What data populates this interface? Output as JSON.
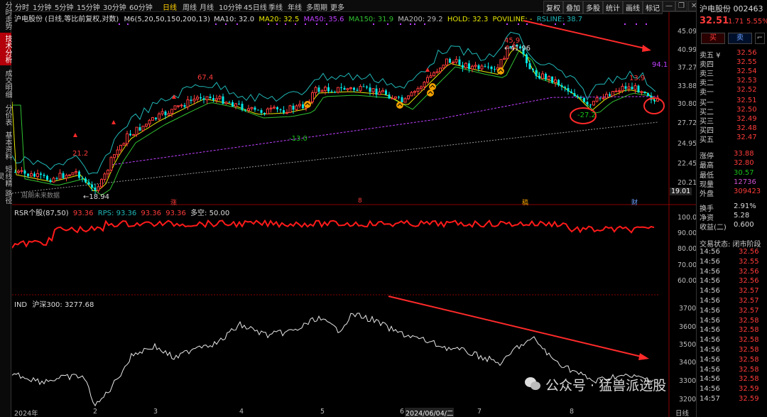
{
  "left_nav": [
    "分时走势",
    "技术分析",
    "成交明细",
    "分价表",
    "基本资料",
    "短线精灵",
    "路径"
  ],
  "toolbar": {
    "periods": [
      "分时",
      "1分钟",
      "5分钟",
      "15分钟",
      "30分钟",
      "60分钟",
      "日线",
      "周线",
      "月线",
      "10分钟",
      "45日线",
      "季线",
      "年线",
      "多周期",
      "更多"
    ],
    "active_period": "日线",
    "right_buttons": [
      "复权",
      "叠加",
      "多股",
      "统计",
      "画线",
      "标记"
    ]
  },
  "main_legend": {
    "stock": "沪电股份 (日线,等比前复权,对数)",
    "m6": "M6(5,20,50,150,200,13)",
    "ma10": "MA10: 32.0",
    "ma20": "MA20: 32.5",
    "ma50": "MA50: 35.6",
    "ma150": "MA150: 31.9",
    "ma200": "MA200: 29.2",
    "hold": "HOLD: 32.3",
    "poviline": "POVILINE: -",
    "rsline": "RSLINE: 38.7"
  },
  "price_axis": [
    "45.09",
    "40.99",
    "37.27",
    "33.88",
    "30.80",
    "27.72",
    "24.95",
    "22.45",
    "20.21",
    "19.01"
  ],
  "annotations": {
    "high1": "21.2",
    "low1": "18.94",
    "high2": "67.4",
    "low2": "-13.0",
    "high3": "45.9",
    "high3b": "41.96",
    "mid": "-27.2",
    "right1": "94.1",
    "right2": "13.9",
    "nodata": "周期未来数据"
  },
  "event_markers": [
    "涨",
    "8",
    "稿",
    "财"
  ],
  "rsr_legend": {
    "title": "RSR个股(87,50)",
    "v1": "93.36",
    "rps": "RPS: 93.36",
    "v2": "93.36",
    "v3": "93.36",
    "duo": "多空: 50.00"
  },
  "rsr_axis": [
    "100.0",
    "90.00",
    "80.00",
    "70.00",
    "60.00"
  ],
  "ind_legend": {
    "title": "IND",
    "index": "沪深300: 3277.68"
  },
  "ind_axis": [
    "3700",
    "3600",
    "3500",
    "3400",
    "3300",
    "3200"
  ],
  "date_axis": [
    "2024年",
    "2",
    "3",
    "4",
    "5",
    "6",
    "2024/06/04/二",
    "7",
    "8"
  ],
  "date_axis_right": "日线",
  "right_panel": {
    "title": "沪电股份 002463",
    "price": "32.51",
    "change": "1.71",
    "change_pct": "5.55%",
    "buy_btn": "买",
    "sell_btn": "卖",
    "order_book": [
      {
        "label": "卖五 ¥",
        "price": "32.56"
      },
      {
        "label": "卖四",
        "price": "32.55"
      },
      {
        "label": "卖三",
        "price": "32.54"
      },
      {
        "label": "卖二",
        "price": "32.53"
      },
      {
        "label": "卖一",
        "price": "32.52"
      },
      {
        "label": "买一",
        "price": "32.51"
      },
      {
        "label": "买二",
        "price": "32.50"
      },
      {
        "label": "买三",
        "price": "32.49"
      },
      {
        "label": "买四",
        "price": "32.48"
      },
      {
        "label": "买五",
        "price": "32.47"
      }
    ],
    "info": [
      {
        "label": "涨停",
        "value": "33.88",
        "color": "#ff3b3b"
      },
      {
        "label": "最高",
        "value": "32.80",
        "color": "#ff3b3b"
      },
      {
        "label": "最低",
        "value": "30.57",
        "color": "#19c019"
      },
      {
        "label": "现量",
        "value": "12736",
        "color": "#d050d0"
      },
      {
        "label": "外盘",
        "value": "309423",
        "color": "#ff3b3b"
      },
      {
        "label": "换手",
        "value": "2.91%",
        "color": "#dddddd"
      },
      {
        "label": "净资",
        "value": "5.28",
        "color": "#dddddd"
      },
      {
        "label": "收益(二)",
        "value": "0.600",
        "color": "#dddddd"
      }
    ],
    "trade_status": "交易状态: 闭市阶段",
    "ticks": [
      {
        "time": "14:56",
        "price": "32.56"
      },
      {
        "time": "14:56",
        "price": "32.55"
      },
      {
        "time": "14:56",
        "price": "32.56"
      },
      {
        "time": "14:56",
        "price": "32.56"
      },
      {
        "time": "14:56",
        "price": "32.57"
      },
      {
        "time": "14:56",
        "price": "32.57"
      },
      {
        "time": "14:56",
        "price": "32.57"
      },
      {
        "time": "14:56",
        "price": "32.58"
      },
      {
        "time": "14:56",
        "price": "32.58"
      },
      {
        "time": "14:56",
        "price": "32.58"
      },
      {
        "time": "14:56",
        "price": "32.58"
      },
      {
        "time": "14:56",
        "price": "32.58"
      },
      {
        "time": "14:56",
        "price": "32.58"
      },
      {
        "time": "14:56",
        "price": "32.58"
      },
      {
        "time": "14:56",
        "price": "32.59"
      },
      {
        "time": "14:57",
        "price": "32.59"
      }
    ]
  },
  "watermark": "公众号 · 猛兽派选股",
  "colors": {
    "up": "#ff3b3b",
    "down": "#00e5e5",
    "ma_yellow": "#e8e800",
    "ma_green": "#30c030",
    "ma_purple": "#c040ff",
    "rs_line": "#20b8b8",
    "ma_gray": "#9a9a9a",
    "rsr_line": "#ff1a1a",
    "ind_line": "#e8e8e8",
    "arrow": "#ff2a2a"
  }
}
